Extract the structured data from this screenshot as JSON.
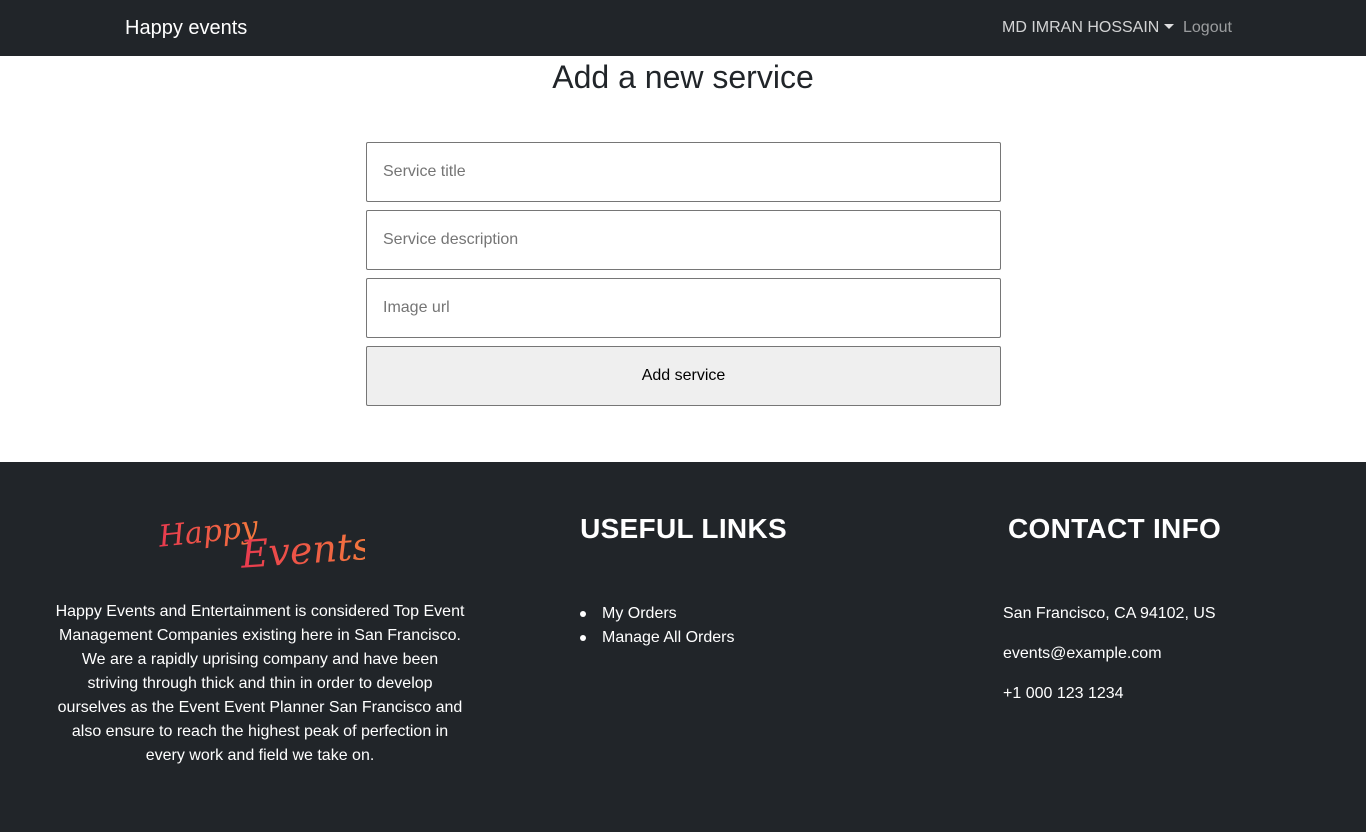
{
  "navbar": {
    "brand": "Happy events",
    "user_name": "MD IMRAN HOSSAIN",
    "logout_label": "Logout"
  },
  "main": {
    "title": "Add a new service",
    "form": {
      "title_placeholder": "Service title",
      "title_value": "",
      "description_placeholder": "Service description",
      "description_value": "",
      "image_placeholder": "Image url",
      "image_value": "",
      "submit_label": "Add service"
    }
  },
  "footer": {
    "logo_text_1": "Happy",
    "logo_text_2": "Events",
    "about": "Happy Events and Entertainment is considered Top Event Management Companies existing here in San Francisco. We are a rapidly uprising company and have been striving through thick and thin in order to develop ourselves as the Event Event Planner San Francisco and also ensure to reach the highest peak of perfection in every work and field we take on.",
    "links_heading": "USEFUL LINKS",
    "links": [
      {
        "label": "My Orders"
      },
      {
        "label": "Manage All Orders"
      }
    ],
    "contact_heading": "CONTACT INFO",
    "address": "San Francisco, CA 94102, US",
    "email": "events@example.com",
    "phone": "+1 000 123 1234"
  },
  "colors": {
    "dark": "#212529",
    "logo_gradient_start": "#e8394f",
    "logo_gradient_end": "#f47a3c"
  }
}
